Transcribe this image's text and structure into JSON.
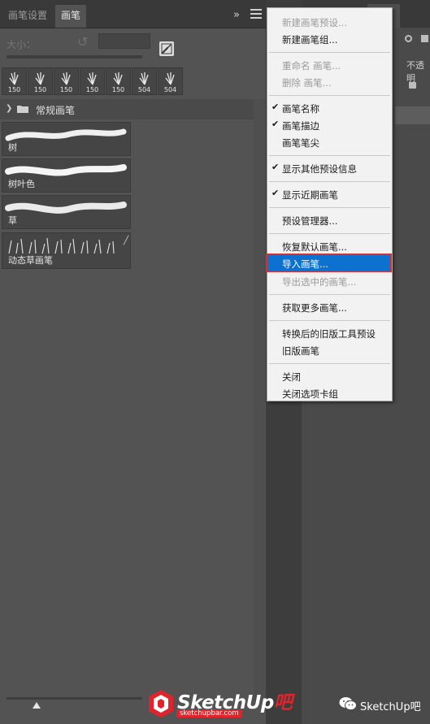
{
  "panel": {
    "tabs": [
      {
        "label": "画笔设置",
        "active": false
      },
      {
        "label": "画笔",
        "active": true
      }
    ],
    "collapse_glyph": "»",
    "size_label": "大小：",
    "recent_brushes": [
      "150",
      "150",
      "150",
      "150",
      "150",
      "504",
      "504"
    ],
    "brush_group": {
      "label": "常规画笔"
    },
    "brushes": [
      {
        "name": "树"
      },
      {
        "name": "树叶色"
      },
      {
        "name": "草"
      },
      {
        "name": "动态草画笔"
      }
    ]
  },
  "menu": {
    "items": [
      {
        "label": "新建画笔预设...",
        "disabled": true,
        "checked": false
      },
      {
        "label": "新建画笔组...",
        "disabled": false,
        "checked": false
      },
      {
        "label": "重命名 画笔...",
        "disabled": true,
        "checked": false
      },
      {
        "label": "删除 画笔...",
        "disabled": true,
        "checked": false
      },
      {
        "label": "画笔名称",
        "disabled": false,
        "checked": true
      },
      {
        "label": "画笔描边",
        "disabled": false,
        "checked": true
      },
      {
        "label": "画笔笔尖",
        "disabled": false,
        "checked": false
      },
      {
        "label": "显示其他预设信息",
        "disabled": false,
        "checked": true
      },
      {
        "label": "显示近期画笔",
        "disabled": false,
        "checked": true
      },
      {
        "label": "预设管理器...",
        "disabled": false,
        "checked": false
      },
      {
        "label": "恢复默认画笔...",
        "disabled": false,
        "checked": false
      },
      {
        "label": "导入画笔...",
        "disabled": false,
        "checked": false,
        "highlighted": true
      },
      {
        "label": "导出选中的画笔...",
        "disabled": true,
        "checked": false
      },
      {
        "label": "获取更多画笔...",
        "disabled": false,
        "checked": false
      },
      {
        "label": "转换后的旧版工具预设",
        "disabled": false,
        "checked": false
      },
      {
        "label": "旧版画笔",
        "disabled": false,
        "checked": false
      },
      {
        "label": "关闭",
        "disabled": false,
        "checked": false
      },
      {
        "label": "关闭选项卡组",
        "disabled": false,
        "checked": false
      }
    ]
  },
  "right_panel": {
    "opacity_label": "不透明"
  },
  "watermark": {
    "logo_text": "SketchUp",
    "logo_char": "吧",
    "logo_url": "sketchupbar.com",
    "wechat_name": "SketchUp吧"
  },
  "colors": {
    "panel_bg": "#535353",
    "menu_bg": "#f2f2f2",
    "highlight": "#0d72cf",
    "callout_red": "#d63030",
    "brand_red": "#e0242b"
  },
  "icons": {
    "reset": "reset-icon",
    "create_brush": "create-brush-icon",
    "group_chevron": "chevron-right-icon",
    "group_folder": "folder-icon",
    "check": "checkmark-icon",
    "wechat": "wechat-icon"
  }
}
